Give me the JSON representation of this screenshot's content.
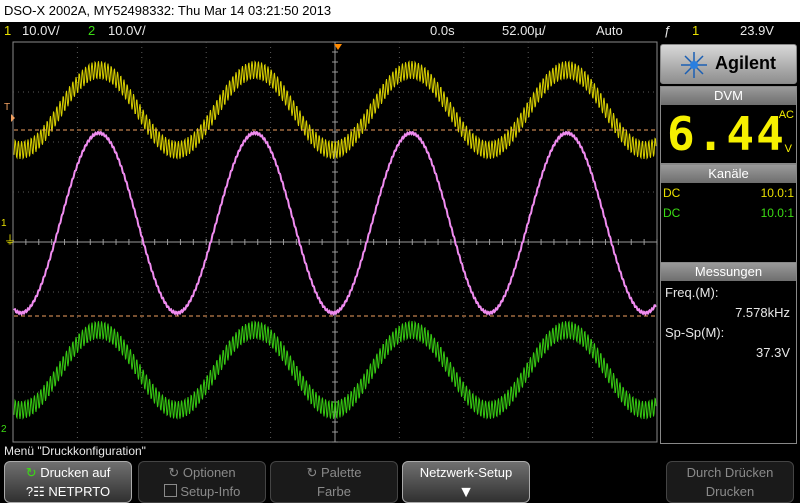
{
  "title": "DSO-X 2002A, MY52498332: Thu Mar 14 03:21:50 2013",
  "status": {
    "ch1_num": "1",
    "ch1_scale": "10.0V/",
    "ch2_num": "2",
    "ch2_scale": "10.0V/",
    "time_offset": "0.0s",
    "time_scale": "52.00µ/",
    "trigger_mode": "Auto",
    "trigger_icon": "ƒ",
    "trigger_src": "1",
    "trigger_level": "23.9V"
  },
  "markers": {
    "trig": "T",
    "ch1": "1",
    "ch2": "2"
  },
  "brand": "Agilent",
  "dvm": {
    "header": "DVM",
    "value": "6.44",
    "mode": "AC",
    "unit": "V"
  },
  "channels": {
    "header": "Kanäle",
    "rows": [
      {
        "coupling": "DC",
        "probe": "10.0:1"
      },
      {
        "coupling": "DC",
        "probe": "10.0:1"
      }
    ]
  },
  "measurements": {
    "header": "Messungen",
    "freq_label": "Freq.(M):",
    "freq_value": "7.578kHz",
    "vpp_label": "Sp-Sp(M):",
    "vpp_value": "37.3V"
  },
  "menu_title": "Menü \"Druckkonfiguration\"",
  "softkeys": {
    "print_l1": "Drucken auf",
    "print_l2": "NETPRTO",
    "options_l1": "Optionen",
    "options_l2": "Setup-Info",
    "palette_l1": "Palette",
    "palette_l2": "Farbe",
    "network_l1": "Netzwerk-Setup",
    "finish_l1": "Durch Drücken",
    "finish_l2": "Drucken"
  },
  "colors": {
    "ch1": "#e8e000",
    "ch2": "#3cdc14",
    "math": "#f08cf0",
    "cursor": "#f0a060"
  }
}
